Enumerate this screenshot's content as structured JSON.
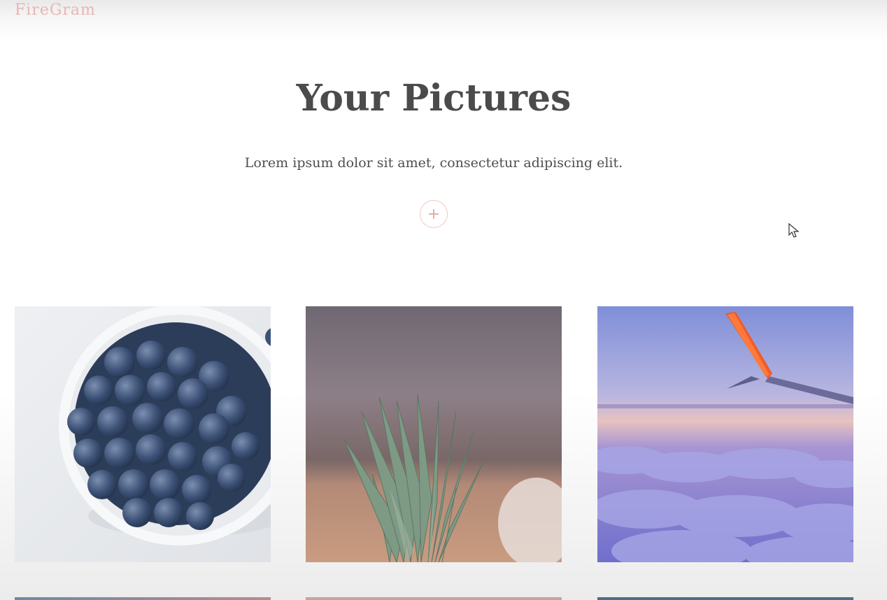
{
  "header": {
    "brand": "FireGram"
  },
  "main": {
    "title": "Your Pictures",
    "subtitle": "Lorem ipsum dolor sit amet, consectetur adipiscing elit.",
    "add_button_label": "+"
  },
  "gallery": {
    "images": [
      {
        "subject": "blueberries",
        "icon": "image-blueberries"
      },
      {
        "subject": "pineapple",
        "icon": "image-pineapple"
      },
      {
        "subject": "airplane wing over clouds",
        "icon": "image-airplane-wing"
      }
    ]
  },
  "colors": {
    "brand": "#e7b7b1",
    "title": "#4b4b4b",
    "accent": "#efc9c4"
  }
}
